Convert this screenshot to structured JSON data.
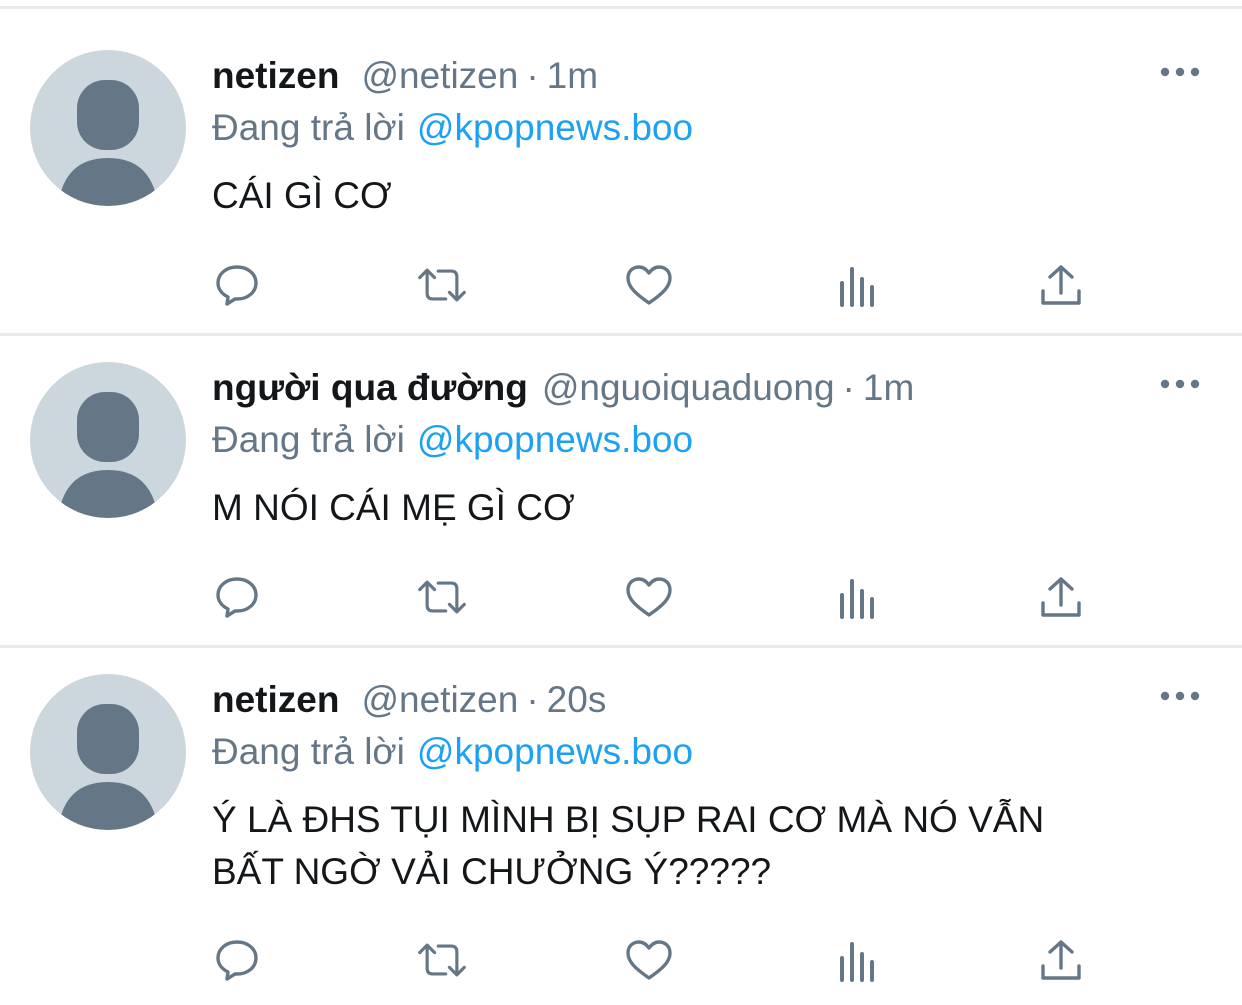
{
  "colors": {
    "primary_text": "#14171a",
    "secondary_text": "#657786",
    "mention": "#1da1f2",
    "avatar_bg": "#ccd6dd",
    "avatar_figure": "#657786",
    "divider": "#e8eaec"
  },
  "tweets": [
    {
      "display_name": "netizen",
      "handle": "@netizen",
      "separator": "·",
      "time": "1m",
      "reply_label": "Đang trả lời",
      "reply_to": "@kpopnews.boo",
      "text_lines": [
        "CÁI GÌ CƠ"
      ],
      "icons": [
        "reply-icon",
        "retweet-icon",
        "like-icon",
        "analytics-icon",
        "share-icon"
      ]
    },
    {
      "display_name": "người qua đường",
      "handle": "@nguoiquaduong",
      "separator": "·",
      "time": "1m",
      "reply_label": "Đang trả lời",
      "reply_to": "@kpopnews.boo",
      "text_lines": [
        "M NÓI CÁI MẸ GÌ CƠ"
      ],
      "icons": [
        "reply-icon",
        "retweet-icon",
        "like-icon",
        "analytics-icon",
        "share-icon"
      ]
    },
    {
      "display_name": "netizen",
      "handle": "@netizen",
      "separator": "·",
      "time": "20s",
      "reply_label": "Đang trả lời",
      "reply_to": "@kpopnews.boo",
      "text_lines": [
        "Ý LÀ ĐHS TỤI MÌNH BỊ SỤP RAI CƠ MÀ NÓ VẪN",
        "BẤT NGỜ VẢI CHƯỞNG Ý?????"
      ],
      "icons": [
        "reply-icon",
        "retweet-icon",
        "like-icon",
        "analytics-icon",
        "share-icon"
      ]
    }
  ]
}
